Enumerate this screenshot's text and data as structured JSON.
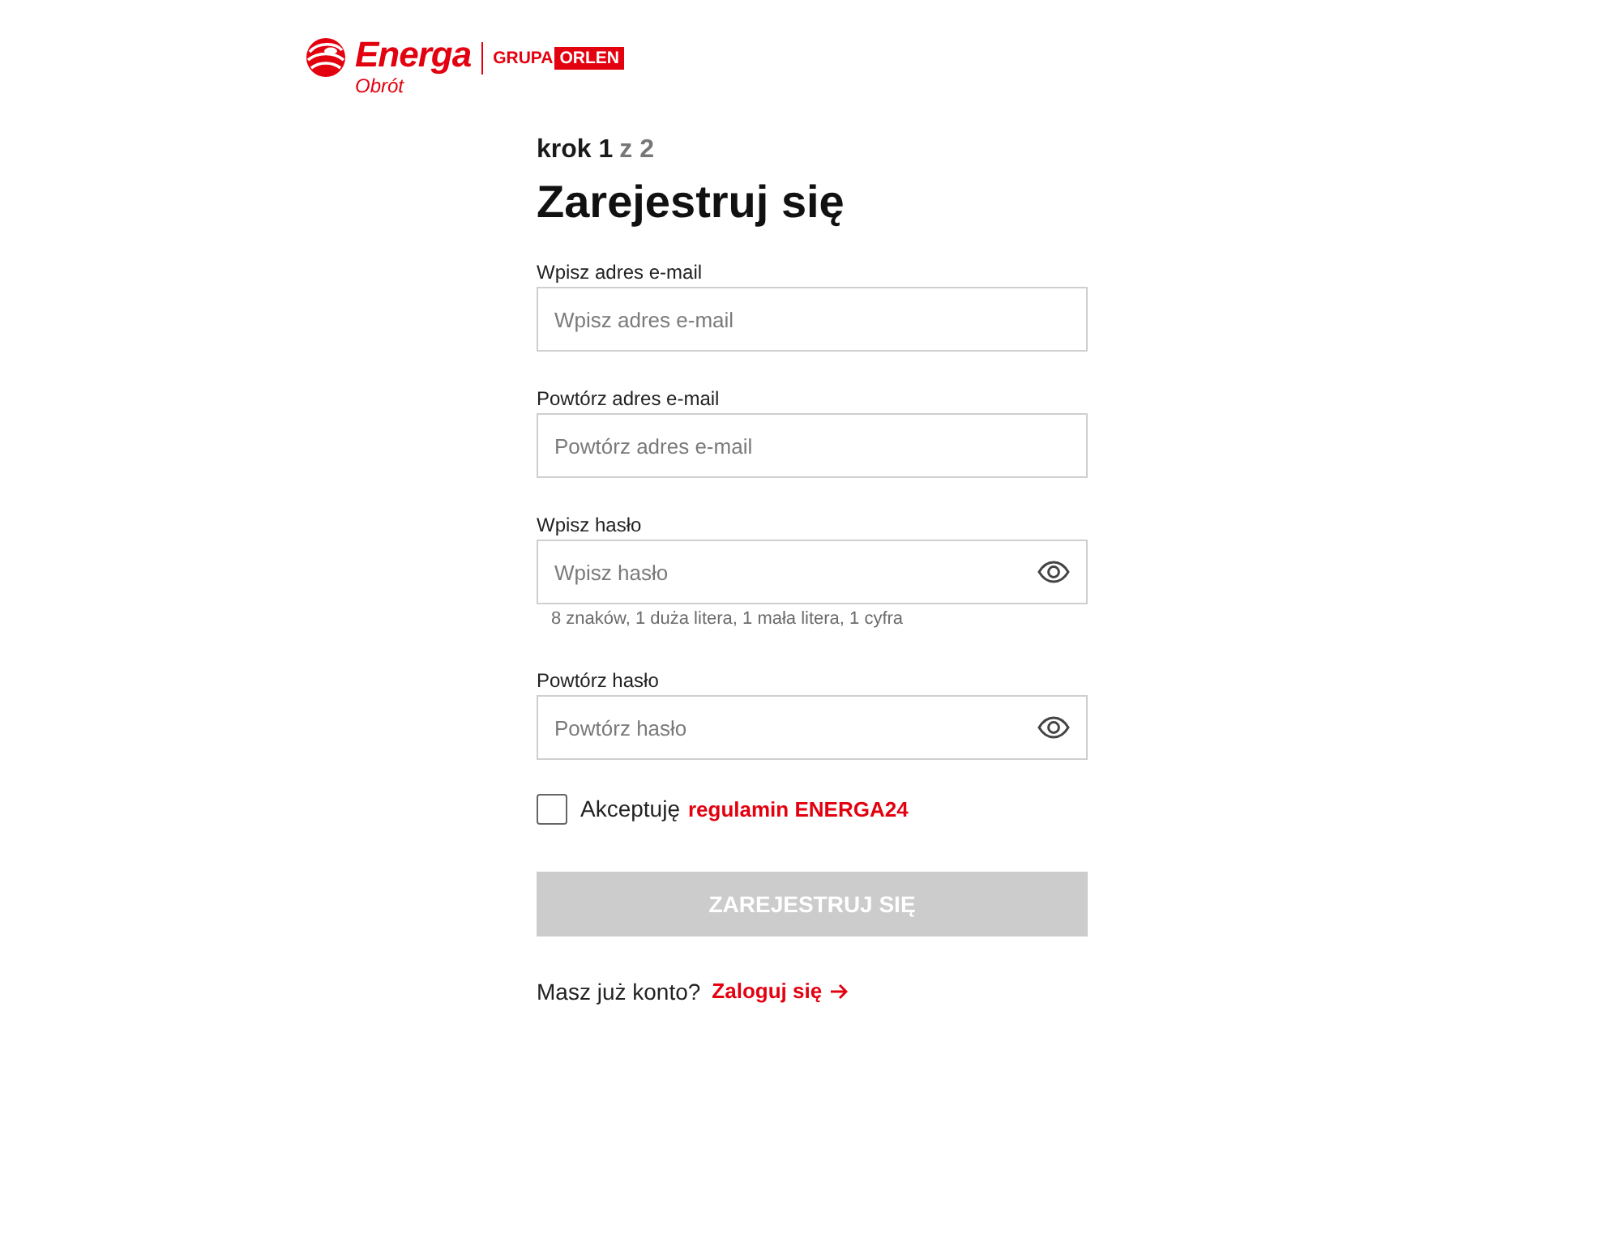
{
  "logo": {
    "brand": "Energa",
    "subtitle": "Obrót",
    "group": "GRUPA",
    "group_brand": "ORLEN"
  },
  "step": {
    "current": "krok 1",
    "total": "z 2"
  },
  "title": "Zarejestruj się",
  "fields": [
    {
      "kind": "text",
      "label": "Wpisz adres e-mail",
      "placeholder": "Wpisz adres e-mail"
    },
    {
      "kind": "text",
      "label": "Powtórz adres e-mail",
      "placeholder": "Powtórz adres e-mail"
    },
    {
      "kind": "password",
      "label": "Wpisz hasło",
      "placeholder": "Wpisz hasło",
      "hint": "8 znaków, 1 duża litera, 1 mała litera, 1 cyfra"
    },
    {
      "kind": "password",
      "label": "Powtórz hasło",
      "placeholder": "Powtórz hasło"
    }
  ],
  "terms": {
    "checked": false,
    "text": "Akceptuję",
    "link": "regulamin ENERGA24"
  },
  "submit": {
    "label": "ZAREJESTRUJ SIĘ",
    "disabled": true
  },
  "login": {
    "text": "Masz już konto?",
    "link": "Zaloguj się"
  }
}
